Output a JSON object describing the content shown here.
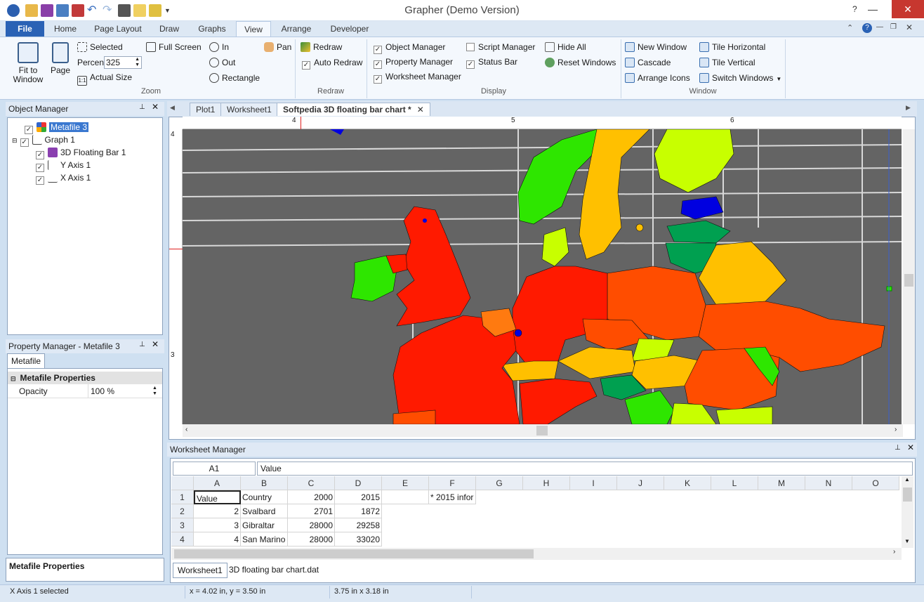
{
  "app": {
    "title": "Grapher (Demo Version)"
  },
  "ribbon_tabs": [
    "File",
    "Home",
    "Page Layout",
    "Draw",
    "Graphs",
    "View",
    "Arrange",
    "Developer"
  ],
  "zoom_group": {
    "label": "Zoom",
    "fit_to_window": "Fit to Window",
    "page": "Page",
    "selected": "Selected",
    "percent_label": "Percent",
    "percent_value": "325",
    "actual_size": "Actual Size",
    "full_screen": "Full Screen",
    "in": "In",
    "out": "Out",
    "rectangle": "Rectangle",
    "pan": "Pan"
  },
  "redraw_group": {
    "label": "Redraw",
    "redraw": "Redraw",
    "auto_redraw": "Auto Redraw"
  },
  "display_group": {
    "label": "Display",
    "object_manager": "Object Manager",
    "property_manager": "Property Manager",
    "worksheet_manager": "Worksheet Manager",
    "script_manager": "Script Manager",
    "status_bar": "Status Bar",
    "hide_all": "Hide All",
    "reset_windows": "Reset Windows"
  },
  "window_group": {
    "label": "Window",
    "new_window": "New Window",
    "cascade": "Cascade",
    "arrange_icons": "Arrange Icons",
    "tile_horizontal": "Tile Horizontal",
    "tile_vertical": "Tile Vertical",
    "switch_windows": "Switch Windows"
  },
  "object_manager": {
    "title": "Object Manager",
    "items": [
      "Metafile 3",
      "Graph 1",
      "3D Floating Bar 1",
      "Y Axis 1",
      "X Axis 1"
    ]
  },
  "property_manager": {
    "title": "Property Manager - Metafile 3",
    "tab": "Metafile",
    "section": "Metafile Properties",
    "opacity_label": "Opacity",
    "opacity_value": "100 %",
    "footer": "Metafile Properties"
  },
  "doc_tabs": [
    "Plot1",
    "Worksheet1",
    "Softpedia 3D floating bar chart *"
  ],
  "ruler": {
    "top": [
      "4",
      "5",
      "6"
    ],
    "left": [
      "4",
      "3"
    ]
  },
  "worksheet": {
    "title": "Worksheet Manager",
    "cell_ref": "A1",
    "cell_value": "Value",
    "columns": [
      "A",
      "B",
      "C",
      "D",
      "E",
      "F",
      "G",
      "H",
      "I",
      "J",
      "K",
      "L",
      "M",
      "N",
      "O"
    ],
    "rows": [
      {
        "num": "1",
        "a": "Value",
        "b": "Country",
        "c": "2000",
        "d": "2015",
        "f": "* 2015 infor"
      },
      {
        "num": "2",
        "a": "2",
        "b": "Svalbard",
        "c": "2701",
        "d": "1872",
        "f": ""
      },
      {
        "num": "3",
        "a": "3",
        "b": "Gibraltar",
        "c": "28000",
        "d": "29258",
        "f": ""
      },
      {
        "num": "4",
        "a": "4",
        "b": "San Marino",
        "c": "28000",
        "d": "33020",
        "f": ""
      }
    ],
    "sheet_tabs": [
      "Worksheet1",
      "3D floating bar chart.dat"
    ]
  },
  "status": {
    "selection": "X Axis 1 selected",
    "coords": "x = 4.02 in, y = 3.50 in",
    "size": "3.75 in x 3.18 in"
  },
  "colors": {
    "red": "#ff1a00",
    "orange_red": "#ff4d00",
    "orange": "#ffc000",
    "yellow_green": "#c8ff00",
    "green": "#2ee600",
    "dark_green": "#00a050",
    "blue": "#0000e0",
    "map_bg": "#646464"
  }
}
